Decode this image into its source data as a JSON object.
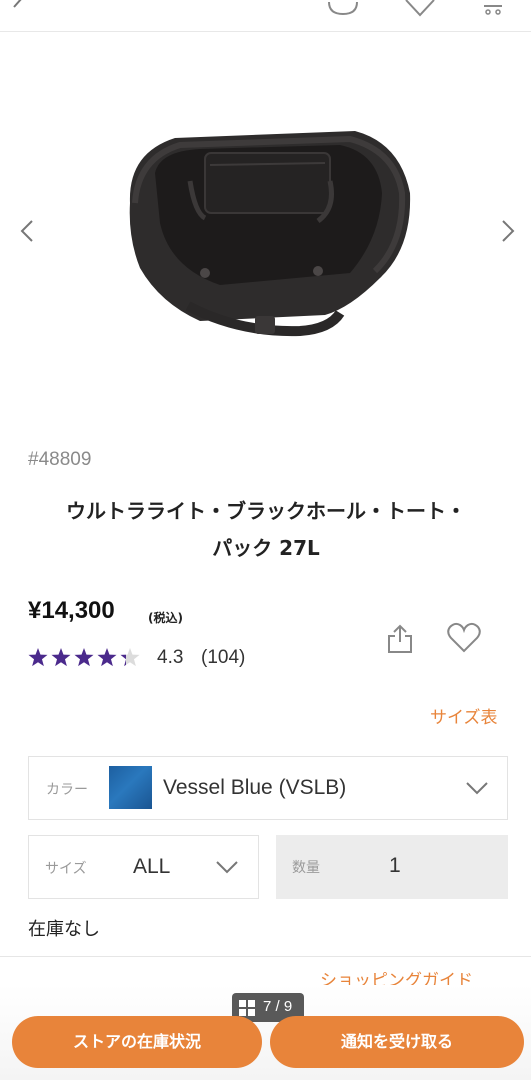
{
  "header": {
    "back_icon": "chevron-left-icon",
    "chat_icon": "chat-icon",
    "wishlist_icon": "heart-icon",
    "cart_icon": "cart-icon"
  },
  "gallery": {
    "prev_icon": "chevron-left-icon",
    "next_icon": "chevron-right-icon",
    "counter": "7 / 9"
  },
  "product": {
    "sku": "#48809",
    "title_line1": "ウルトラライト・ブラックホール・トート・",
    "title_line2": "パック 27L",
    "price": "¥14,300",
    "tax_label": "(税込)",
    "rating_value": 4.3,
    "rating_text": "4.3",
    "review_count": "(104)",
    "star_color": "#4b2a8c"
  },
  "options": {
    "size_chart_link": "サイズ表",
    "color_label": "カラー",
    "color_value": "Vessel Blue (VSLB)",
    "size_label": "サイズ",
    "size_value": "ALL",
    "quantity_label": "数量",
    "quantity_value": "1",
    "stock_status": "在庫なし"
  },
  "footer": {
    "shopping_guide": "ショッピングガイド",
    "store_stock_button": "ストアの在庫状況",
    "notify_button": "通知を受け取る",
    "accent_color": "#e8843a"
  }
}
